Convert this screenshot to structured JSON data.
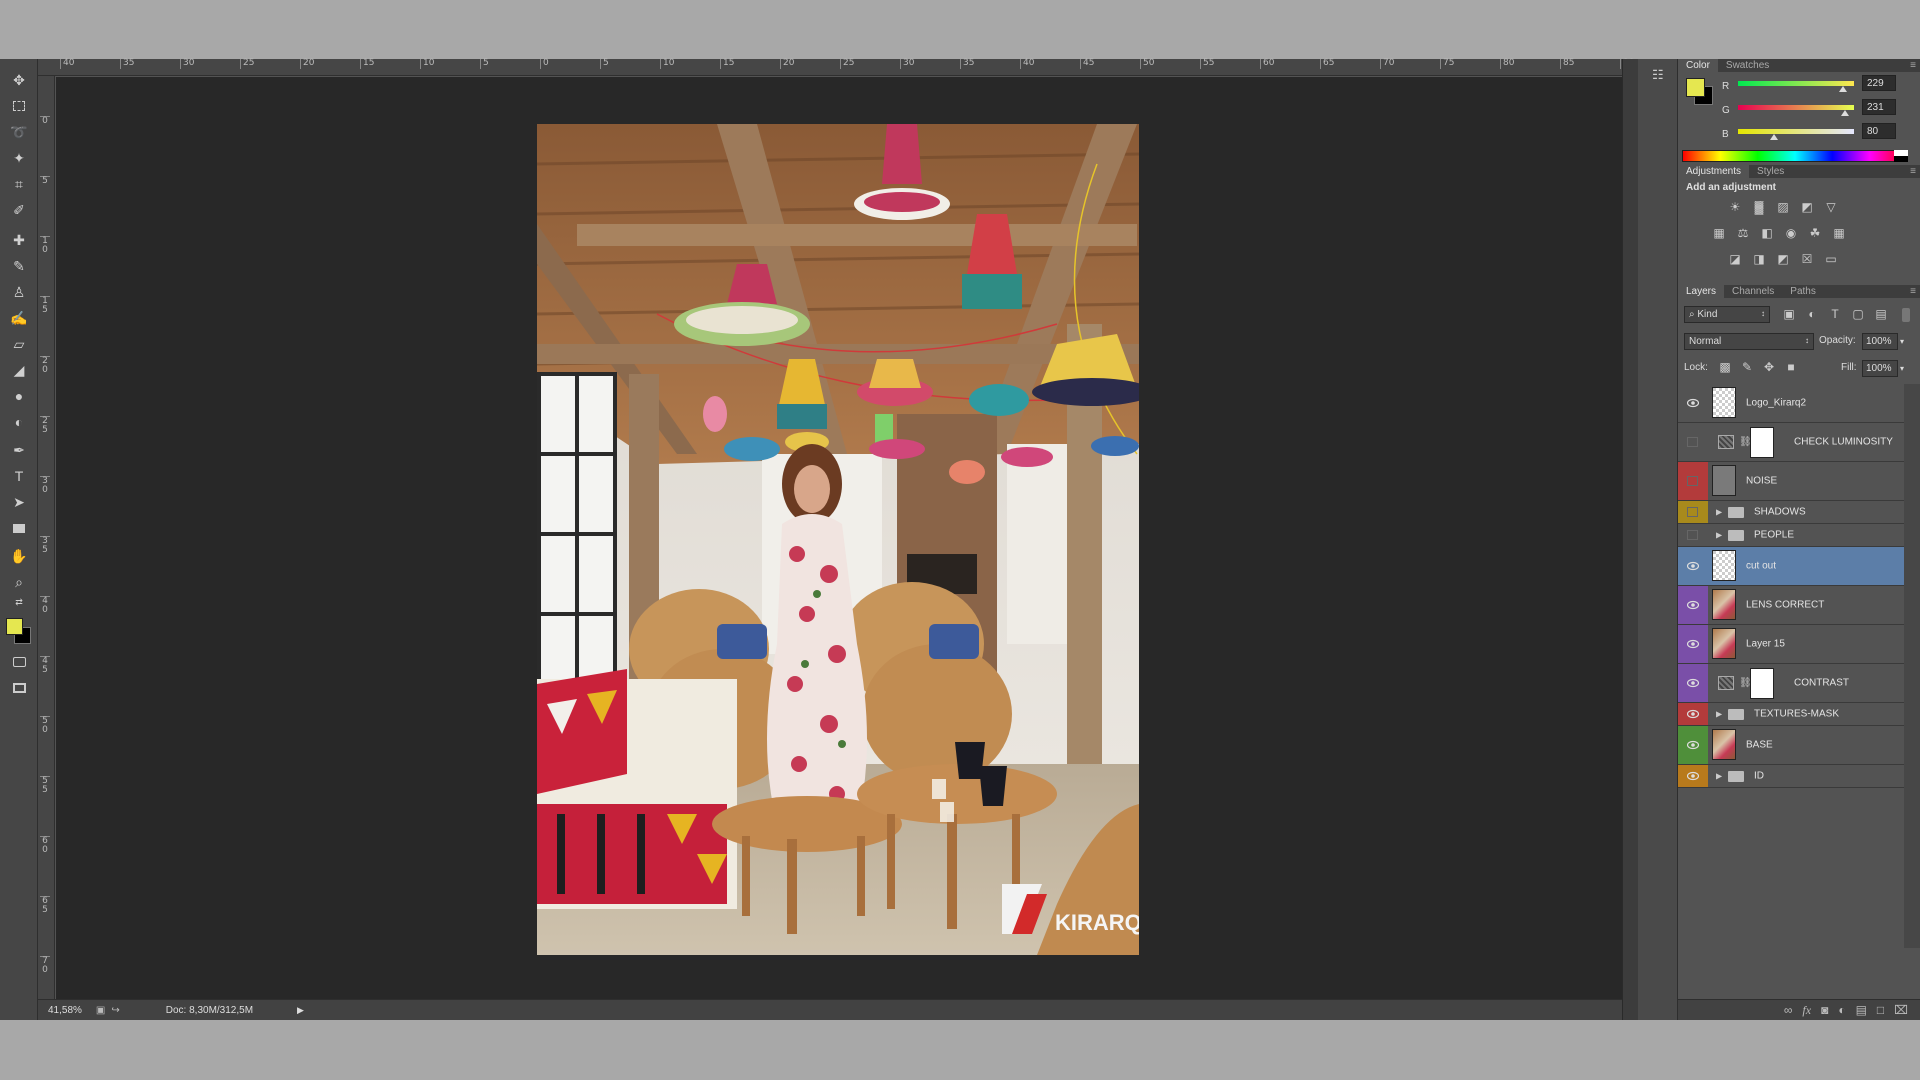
{
  "status": {
    "zoom": "41,58%",
    "doc": "Doc: 8,30M/312,5M"
  },
  "ruler_top": [
    "40",
    "35",
    "30",
    "25",
    "20",
    "15",
    "10",
    "5",
    "0",
    "5",
    "10",
    "15",
    "20",
    "25",
    "30",
    "35",
    "40",
    "45",
    "50",
    "55",
    "60",
    "65",
    "70",
    "75",
    "80",
    "85",
    "90"
  ],
  "ruler_left": [
    "0",
    "5",
    "1\n0",
    "1\n5",
    "2\n0",
    "2\n5",
    "3\n0",
    "3\n5",
    "4\n0",
    "4\n5",
    "5\n0",
    "5\n5",
    "6\n0",
    "6\n5",
    "7\n0"
  ],
  "color_panel": {
    "tabs": [
      "Color",
      "Swatches"
    ],
    "channels": [
      {
        "label": "R",
        "value": "229"
      },
      {
        "label": "G",
        "value": "231"
      },
      {
        "label": "B",
        "value": "80"
      }
    ],
    "foreground": "#e5e750"
  },
  "adjustments": {
    "tabs": [
      "Adjustments",
      "Styles"
    ],
    "title": "Add an adjustment"
  },
  "layers_panel": {
    "tabs": [
      "Layers",
      "Channels",
      "Paths"
    ],
    "filter": "Kind",
    "blend": "Normal",
    "opacity_label": "Opacity:",
    "opacity": "100%",
    "lock_label": "Lock:",
    "fill_label": "Fill:",
    "fill": "100%",
    "layers": [
      {
        "name": "Logo_Kirarq2",
        "color": "",
        "visible": true,
        "type": "smart"
      },
      {
        "name": "CHECK LUMINOSITY",
        "color": "",
        "visible": false,
        "type": "adjust"
      },
      {
        "name": "NOISE",
        "color": "#b33b3b",
        "visible": false,
        "type": "gray"
      },
      {
        "name": "SHADOWS",
        "color": "#a88a1c",
        "visible": false,
        "type": "group"
      },
      {
        "name": "PEOPLE",
        "color": "",
        "visible": false,
        "type": "group"
      },
      {
        "name": "cut out",
        "color": "",
        "visible": true,
        "type": "smart",
        "selected": true
      },
      {
        "name": "LENS CORRECT",
        "color": "#7a4fa8",
        "visible": true,
        "type": "photo"
      },
      {
        "name": "Layer 15",
        "color": "#7a4fa8",
        "visible": true,
        "type": "photo"
      },
      {
        "name": "CONTRAST",
        "color": "#7a4fa8",
        "visible": true,
        "type": "adjust"
      },
      {
        "name": "TEXTURES-MASK",
        "color": "#b33b3b",
        "visible": true,
        "type": "group"
      },
      {
        "name": "BASE",
        "color": "#4f8f3a",
        "visible": true,
        "type": "photo"
      },
      {
        "name": "ID",
        "color": "#b87a1c",
        "visible": true,
        "type": "group"
      }
    ]
  },
  "photo": {
    "logo_text": "KIRARQ"
  }
}
